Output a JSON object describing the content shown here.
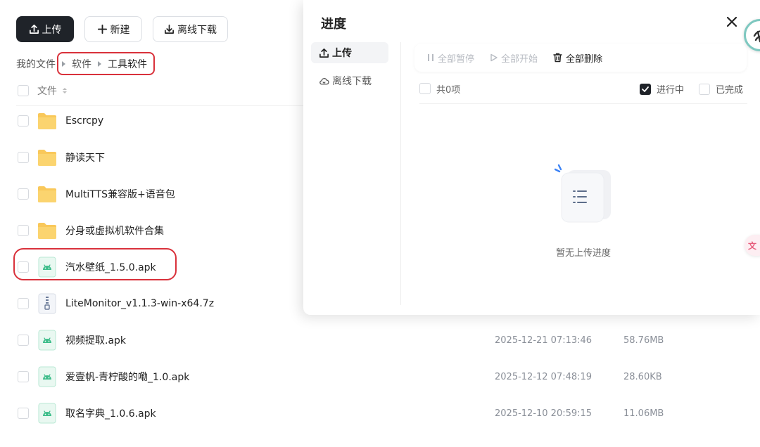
{
  "toolbar": {
    "upload_label": "上传",
    "new_label": "新建",
    "offline_label": "离线下载"
  },
  "breadcrumb": [
    "我的文件",
    "软件",
    "工具软件"
  ],
  "list_header": {
    "file_label": "文件"
  },
  "files": [
    {
      "name": "Escrcpy",
      "type": "folder",
      "time": "",
      "size": ""
    },
    {
      "name": "静读天下",
      "type": "folder",
      "time": "",
      "size": ""
    },
    {
      "name": "MultiTTS兼容版+语音包",
      "type": "folder",
      "time": "",
      "size": ""
    },
    {
      "name": "分身或虚拟机软件合集",
      "type": "folder",
      "time": "",
      "size": ""
    },
    {
      "name": "汽水壁纸_1.5.0.apk",
      "type": "apk",
      "time": "",
      "size": ""
    },
    {
      "name": "LiteMonitor_v1.1.3-win-x64.7z",
      "type": "archive",
      "time": "",
      "size": ""
    },
    {
      "name": "视频提取.apk",
      "type": "apk",
      "time": "2025-12-21 07:13:46",
      "size": "58.76MB"
    },
    {
      "name": "爱壹帆-青柠酸的嘞_1.0.apk",
      "type": "apk",
      "time": "2025-12-12 07:48:19",
      "size": "28.60KB"
    },
    {
      "name": "取名字典_1.0.6.apk",
      "type": "apk",
      "time": "2025-12-10 20:59:15",
      "size": "11.06MB"
    }
  ],
  "panel": {
    "title": "进度",
    "tabs": [
      {
        "label": "上传",
        "icon": "upload-icon",
        "active": true
      },
      {
        "label": "离线下载",
        "icon": "cloud-download-icon",
        "active": false
      }
    ],
    "actions": {
      "pause_all": "全部暂停",
      "start_all": "全部开始",
      "delete_all": "全部删除"
    },
    "total_label": "共0项",
    "filters": {
      "in_progress": "进行中",
      "in_progress_checked": true,
      "completed": "已完成",
      "completed_checked": false
    },
    "empty_text": "暂无上传进度"
  },
  "colors": {
    "primary_dark": "#1f2329",
    "folder": "#f9c85a",
    "apk_green": "#3dbd8a",
    "annotation_red": "#d9313b"
  }
}
